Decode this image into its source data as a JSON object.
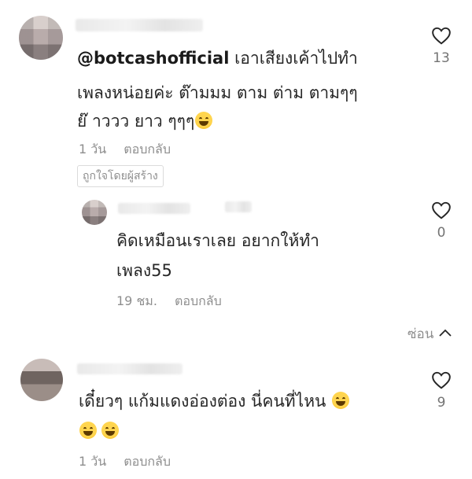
{
  "comments": [
    {
      "mention": "@botcashofficial",
      "line1": " เอาเสียงเค้าไปทำ",
      "line2": "เพลงหน่อยค่ะ ต๊ามมม ตาม ต่าม ตามๆๆ",
      "line3": "ย๊ าววว ยาว ๆๆๆ",
      "time": "1 วัน",
      "reply": "ตอบกลับ",
      "creator_badge": "ถูกใจโดยผู้สร้าง",
      "likes": "13"
    },
    {
      "line1": "คิดเหมือนเราเลย อยากให้ทำ",
      "line2": "เพลง55",
      "time": "19 ชม.",
      "reply": "ตอบกลับ",
      "likes": "0"
    },
    {
      "line1": "เดี๋ยวๆ แก้มแดงอ่องต่อง นี่คนที่ไหน",
      "time": "1 วัน",
      "reply": "ตอบกลับ",
      "likes": "9"
    }
  ],
  "hide_replies": "ซ่อน",
  "icons": {
    "like": "heart-icon",
    "hide": "chevron-up-icon",
    "emoji": "grinning-sweat-emoji"
  }
}
